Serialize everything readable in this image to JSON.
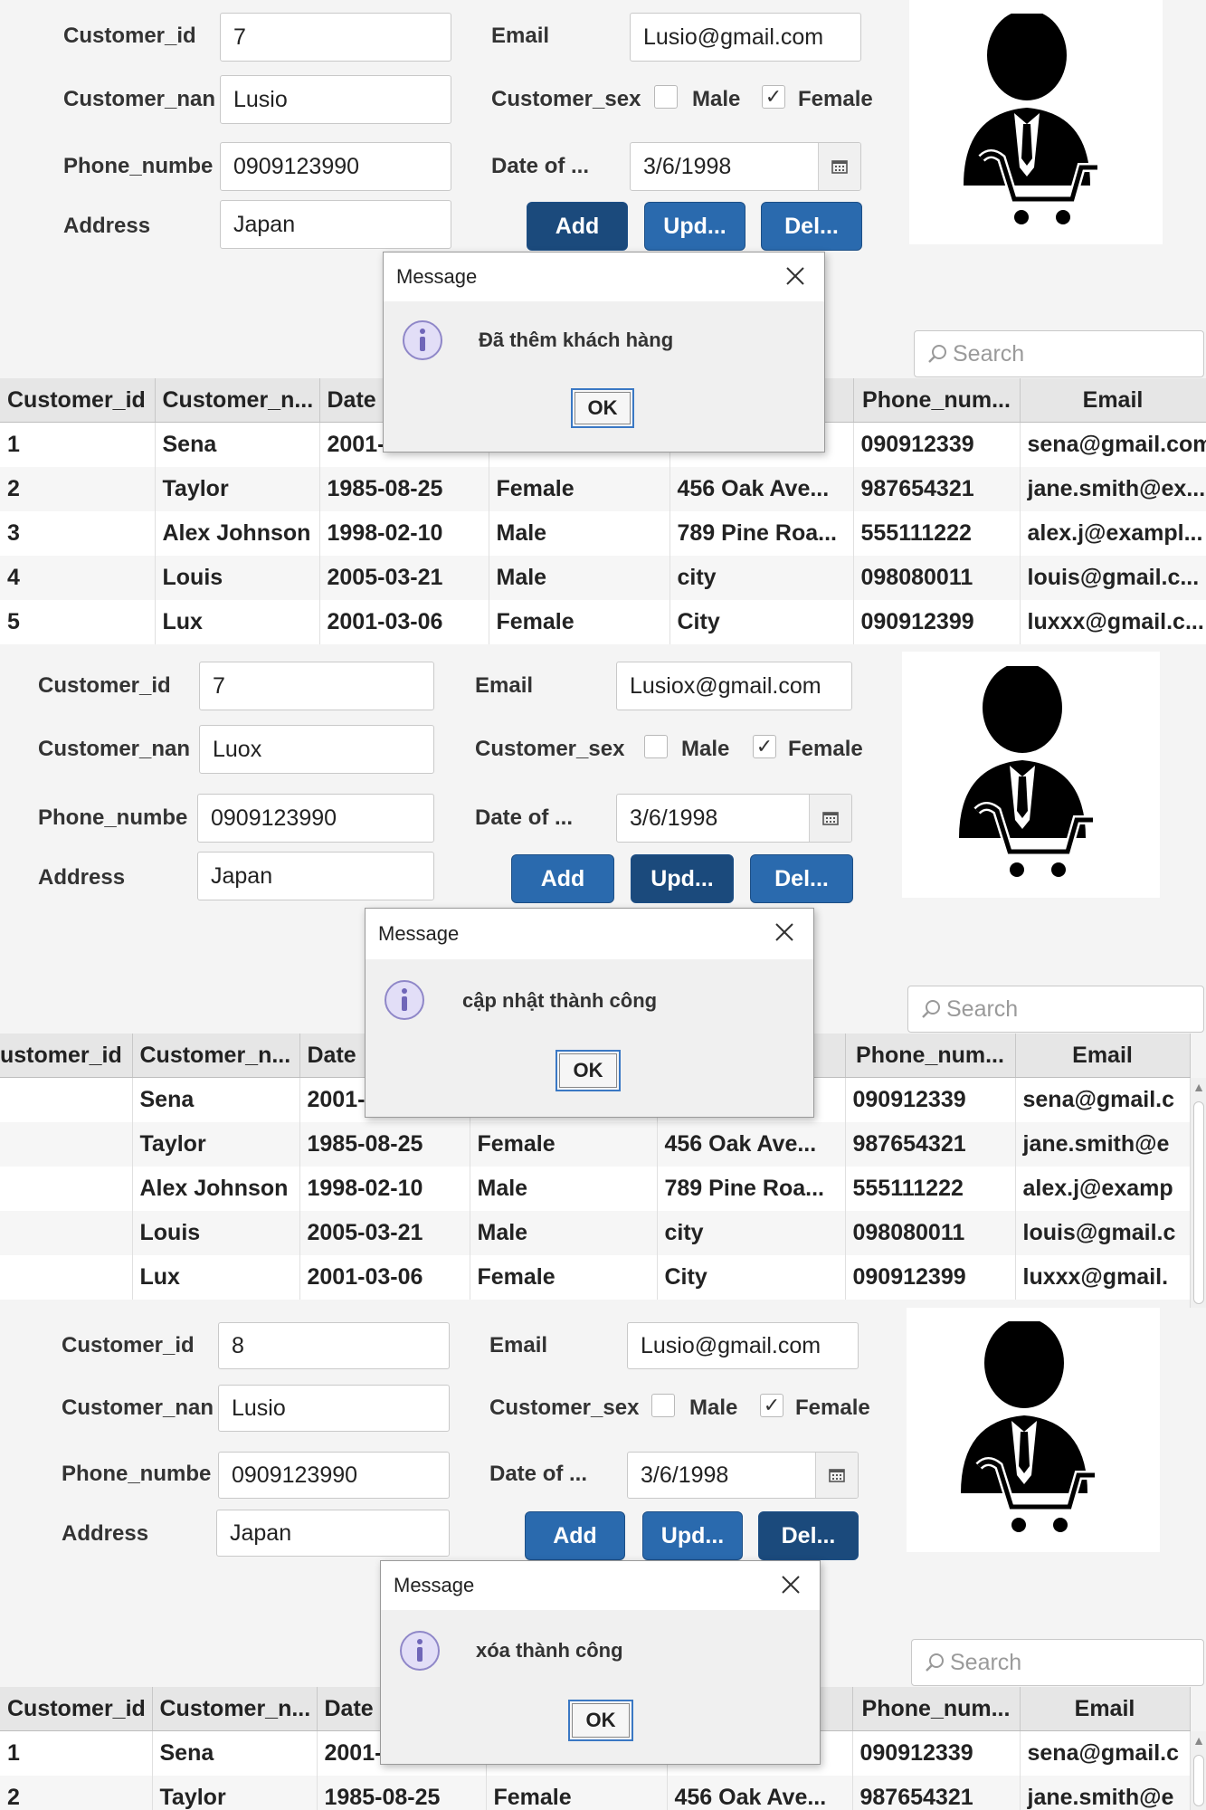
{
  "labels": {
    "customer_id": "Customer_id",
    "customer_name": "Customer_nan",
    "phone": "Phone_numbe",
    "address": "Address",
    "email": "Email",
    "sex": "Customer_sex",
    "male": "Male",
    "female": "Female",
    "date": "Date of ...",
    "add": "Add",
    "update": "Upd...",
    "delete": "Del...",
    "search_placeholder": "Search"
  },
  "columns": {
    "id": "Customer_id",
    "id_cut": "ustomer_id",
    "name": "Customer_n...",
    "date": "Date",
    "phone": "Phone_num...",
    "email": "Email"
  },
  "dialog": {
    "title": "Message",
    "ok": "OK"
  },
  "icons": {
    "calendar": "calendar-icon",
    "search": "search-icon",
    "info": "info-icon",
    "close": "close-icon",
    "avatar": "customer-cart-icon"
  },
  "panels": [
    {
      "form": {
        "customer_id": "7",
        "customer_name": "Lusio",
        "phone": "0909123990",
        "address": "Japan",
        "email": "Lusio@gmail.com",
        "date": "3/6/1998",
        "male_checked": "",
        "female_checked": "✓"
      },
      "message": "Đã thêm khách hàng",
      "rows": [
        {
          "id": "1",
          "name": "Sena",
          "date": "2001-",
          "sex": "",
          "address": "",
          "phone": "090912339",
          "email": "sena@gmail.com"
        },
        {
          "id": "2",
          "name": "Taylor",
          "date": "1985-08-25",
          "sex": "Female",
          "address": "456 Oak Ave...",
          "phone": "987654321",
          "email": "jane.smith@ex..."
        },
        {
          "id": "3",
          "name": "Alex Johnson",
          "date": "1998-02-10",
          "sex": "Male",
          "address": "789 Pine Roa...",
          "phone": "555111222",
          "email": "alex.j@exampl..."
        },
        {
          "id": "4",
          "name": "Louis",
          "date": "2005-03-21",
          "sex": "Male",
          "address": "city",
          "phone": "098080011",
          "email": "louis@gmail.c..."
        },
        {
          "id": "5",
          "name": "Lux",
          "date": "2001-03-06",
          "sex": "Female",
          "address": "City",
          "phone": "090912399",
          "email": "luxxx@gmail.c..."
        }
      ]
    },
    {
      "form": {
        "customer_id": "7",
        "customer_name": "Luox",
        "phone": "0909123990",
        "address": "Japan",
        "email": "Lusiox@gmail.com",
        "date": "3/6/1998",
        "male_checked": "",
        "female_checked": "✓"
      },
      "message": "cập nhật thành công",
      "rows": [
        {
          "id": "",
          "name": "Sena",
          "date": "2001-",
          "sex": "",
          "address": "",
          "phone": "090912339",
          "email": "sena@gmail.c"
        },
        {
          "id": "",
          "name": "Taylor",
          "date": "1985-08-25",
          "sex": "Female",
          "address": "456 Oak Ave...",
          "phone": "987654321",
          "email": "jane.smith@e"
        },
        {
          "id": "",
          "name": "Alex Johnson",
          "date": "1998-02-10",
          "sex": "Male",
          "address": "789 Pine Roa...",
          "phone": "555111222",
          "email": "alex.j@examp"
        },
        {
          "id": "",
          "name": "Louis",
          "date": "2005-03-21",
          "sex": "Male",
          "address": "city",
          "phone": "098080011",
          "email": "louis@gmail.c"
        },
        {
          "id": "",
          "name": "Lux",
          "date": "2001-03-06",
          "sex": "Female",
          "address": "City",
          "phone": "090912399",
          "email": "luxxx@gmail."
        }
      ]
    },
    {
      "form": {
        "customer_id": "8",
        "customer_name": "Lusio",
        "phone": "0909123990",
        "address": "Japan",
        "email": "Lusio@gmail.com",
        "date": "3/6/1998",
        "male_checked": "",
        "female_checked": "✓"
      },
      "message": "xóa thành công",
      "rows": [
        {
          "id": "1",
          "name": "Sena",
          "date": "2001-",
          "sex": "",
          "address": "",
          "phone": "090912339",
          "email": "sena@gmail.c"
        },
        {
          "id": "2",
          "name": "Taylor",
          "date": "1985-08-25",
          "sex": "Female",
          "address": "456 Oak Ave...",
          "phone": "987654321",
          "email": "jane.smith@e"
        }
      ]
    }
  ]
}
